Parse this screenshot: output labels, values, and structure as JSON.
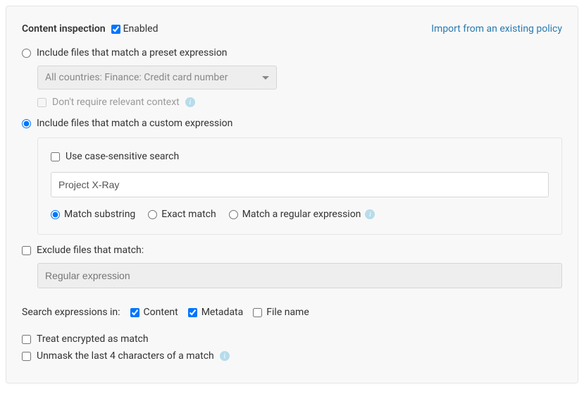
{
  "header": {
    "title": "Content inspection",
    "enabled_label": "Enabled",
    "import_link": "Import from an existing policy"
  },
  "preset": {
    "radio_label": "Include files that match a preset expression",
    "select_value": "All countries: Finance: Credit card number",
    "context_label": "Don't require relevant context"
  },
  "custom": {
    "radio_label": "Include files that match a custom expression",
    "case_sensitive_label": "Use case-sensitive search",
    "input_value": "Project X-Ray",
    "match_substring": "Match substring",
    "exact_match": "Exact match",
    "match_regex": "Match a regular expression"
  },
  "exclude": {
    "label": "Exclude files that match:",
    "placeholder": "Regular expression"
  },
  "search_in": {
    "label": "Search expressions in:",
    "content": "Content",
    "metadata": "Metadata",
    "filename": "File name"
  },
  "footer": {
    "treat_encrypted": "Treat encrypted as match",
    "unmask": "Unmask the last 4 characters of a match"
  }
}
